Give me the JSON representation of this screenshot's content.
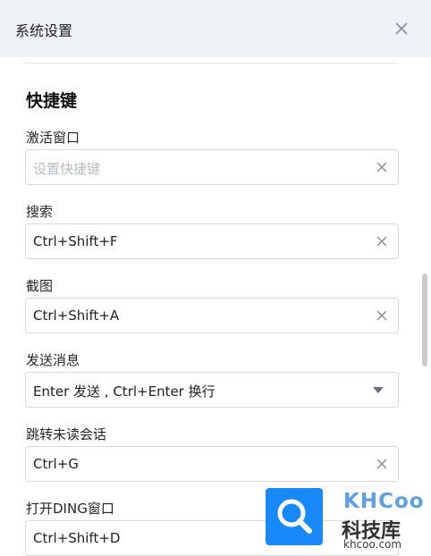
{
  "header": {
    "title": "系统设置"
  },
  "section": {
    "title": "快捷键"
  },
  "shortcuts": [
    {
      "label": "激活窗口",
      "value": "",
      "placeholder": "设置快捷键"
    },
    {
      "label": "搜索",
      "value": "Ctrl+Shift+F"
    },
    {
      "label": "截图",
      "value": "Ctrl+Shift+A"
    },
    {
      "label": "发送消息",
      "value": "Enter 发送 , Ctrl+Enter 换行"
    },
    {
      "label": "跳转未读会话",
      "value": "Ctrl+G"
    },
    {
      "label": "打开DING窗口",
      "value": "Ctrl+Shift+D"
    }
  ],
  "watermark": {
    "brand": "KHCoo",
    "name_cn": "科技库",
    "url": "khcoo.com"
  },
  "colors": {
    "header_bg": "#eef1f6",
    "accent": "#1989fa"
  }
}
